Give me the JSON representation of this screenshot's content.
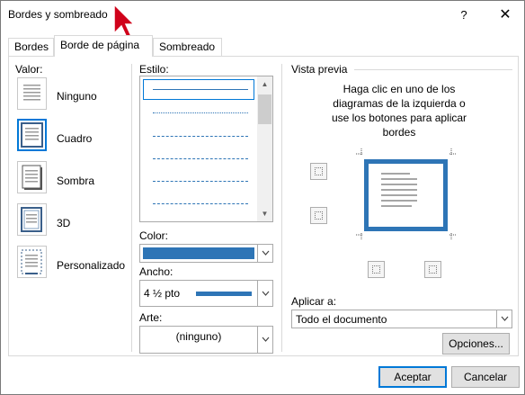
{
  "window": {
    "title": "Bordes y sombreado",
    "help_label": "?",
    "close_label": "✕"
  },
  "tabs": [
    {
      "label": "Bordes",
      "active": false
    },
    {
      "label": "Borde de página",
      "active": true
    },
    {
      "label": "Sombreado",
      "active": false
    }
  ],
  "setting": {
    "label": "Valor:",
    "items": [
      {
        "label": "Ninguno",
        "selected": false
      },
      {
        "label": "Cuadro",
        "selected": true
      },
      {
        "label": "Sombra",
        "selected": false
      },
      {
        "label": "3D",
        "selected": false
      },
      {
        "label": "Personalizado",
        "selected": false
      }
    ]
  },
  "style": {
    "label": "Estilo:",
    "selected_index": 0
  },
  "color": {
    "label": "Color:",
    "value_color": "#2e75b6"
  },
  "width": {
    "label": "Ancho:",
    "value": "4 ½ pto"
  },
  "art": {
    "label": "Arte:",
    "value": "(ninguno)"
  },
  "preview": {
    "label": "Vista previa",
    "description": "Haga clic en uno de los diagramas de la izquierda o use los botones para aplicar bordes"
  },
  "apply_to": {
    "label": "Aplicar a:",
    "value": "Todo el documento"
  },
  "buttons": {
    "options": "Opciones...",
    "ok": "Aceptar",
    "cancel": "Cancelar"
  },
  "colors": {
    "accent": "#0078d7",
    "border_blue": "#2e75b6"
  }
}
